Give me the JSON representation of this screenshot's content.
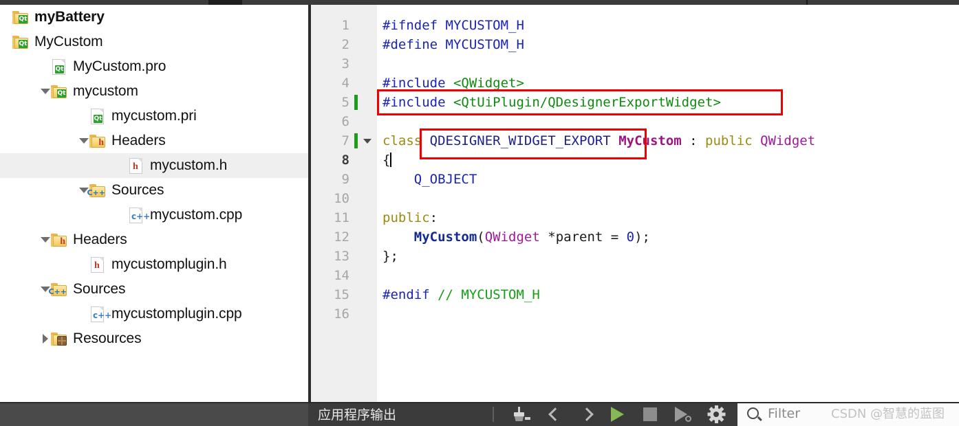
{
  "window": {
    "top_strip": {
      "active_tab_marker": ""
    }
  },
  "sidebar": {
    "name": "project-tree",
    "items": [
      {
        "label": "myBattery",
        "icon": "qt-folder-icon",
        "indent": 0,
        "twisty": "none",
        "bold": true,
        "selected": false
      },
      {
        "label": "MyCustom",
        "icon": "qt-folder-icon",
        "indent": 0,
        "twisty": "none",
        "bold": false,
        "selected": false
      },
      {
        "label": "MyCustom.pro",
        "icon": "qt-file-icon",
        "indent": 1,
        "twisty": "none",
        "bold": false,
        "selected": false
      },
      {
        "label": "mycustom",
        "icon": "qt-folder-icon",
        "indent": 1,
        "twisty": "expanded",
        "bold": false,
        "selected": false
      },
      {
        "label": "mycustom.pri",
        "icon": "qt-file-icon",
        "indent": 2,
        "twisty": "none",
        "bold": false,
        "selected": false
      },
      {
        "label": "Headers",
        "icon": "h-folder-icon",
        "indent": 2,
        "twisty": "expanded",
        "bold": false,
        "selected": false
      },
      {
        "label": "mycustom.h",
        "icon": "h-file-icon",
        "indent": 3,
        "twisty": "none",
        "bold": false,
        "selected": true
      },
      {
        "label": "Sources",
        "icon": "cpp-folder-icon",
        "indent": 2,
        "twisty": "expanded",
        "bold": false,
        "selected": false
      },
      {
        "label": "mycustom.cpp",
        "icon": "cpp-file-icon",
        "indent": 3,
        "twisty": "none",
        "bold": false,
        "selected": false
      },
      {
        "label": "Headers",
        "icon": "h-folder-icon",
        "indent": 1,
        "twisty": "expanded",
        "bold": false,
        "selected": false
      },
      {
        "label": "mycustomplugin.h",
        "icon": "h-file-icon",
        "indent": 2,
        "twisty": "none",
        "bold": false,
        "selected": false
      },
      {
        "label": "Sources",
        "icon": "cpp-folder-icon",
        "indent": 1,
        "twisty": "expanded",
        "bold": false,
        "selected": false
      },
      {
        "label": "mycustomplugin.cpp",
        "icon": "cpp-file-icon",
        "indent": 2,
        "twisty": "none",
        "bold": false,
        "selected": false
      },
      {
        "label": "Resources",
        "icon": "resource-folder-icon",
        "indent": 1,
        "twisty": "collapsed",
        "bold": false,
        "selected": false
      }
    ]
  },
  "editor": {
    "name": "code-editor",
    "filename": "mycustom.h",
    "current_line": 8,
    "lines": [
      {
        "no": "1",
        "change": false,
        "fold": false,
        "current": false,
        "tokens": [
          {
            "t": "#ifndef ",
            "c": "pre"
          },
          {
            "t": "MYCUSTOM_H",
            "c": "macro"
          }
        ]
      },
      {
        "no": "2",
        "change": false,
        "fold": false,
        "current": false,
        "tokens": [
          {
            "t": "#define ",
            "c": "pre"
          },
          {
            "t": "MYCUSTOM_H",
            "c": "macro"
          }
        ]
      },
      {
        "no": "3",
        "change": false,
        "fold": false,
        "current": false,
        "tokens": []
      },
      {
        "no": "4",
        "change": false,
        "fold": false,
        "current": false,
        "tokens": [
          {
            "t": "#include ",
            "c": "pre"
          },
          {
            "t": "<QWidget>",
            "c": "string"
          }
        ]
      },
      {
        "no": "5",
        "change": true,
        "fold": false,
        "current": false,
        "tokens": [
          {
            "t": "#include ",
            "c": "pre"
          },
          {
            "t": "<QtUiPlugin/QDesignerExportWidget>",
            "c": "string"
          }
        ]
      },
      {
        "no": "6",
        "change": false,
        "fold": false,
        "current": false,
        "tokens": []
      },
      {
        "no": "7",
        "change": true,
        "fold": true,
        "current": false,
        "tokens": [
          {
            "t": "class ",
            "c": "keyword"
          },
          {
            "t": "QDESIGNER_WIDGET_EXPORT ",
            "c": "navy"
          },
          {
            "t": "MyCustom",
            "c": "classname"
          },
          {
            "t": " : ",
            "c": "plain"
          },
          {
            "t": "public ",
            "c": "keyword"
          },
          {
            "t": "QWidget",
            "c": "type"
          }
        ]
      },
      {
        "no": "8",
        "change": false,
        "fold": false,
        "current": true,
        "tokens": [
          {
            "t": "{",
            "c": "plain"
          }
        ],
        "caret": true
      },
      {
        "no": "9",
        "change": false,
        "fold": false,
        "current": false,
        "tokens": [
          {
            "t": "    ",
            "c": "plain"
          },
          {
            "t": "Q_OBJECT",
            "c": "macro"
          }
        ]
      },
      {
        "no": "10",
        "change": false,
        "fold": false,
        "current": false,
        "tokens": []
      },
      {
        "no": "11",
        "change": false,
        "fold": false,
        "current": false,
        "tokens": [
          {
            "t": "public",
            "c": "keyword"
          },
          {
            "t": ":",
            "c": "plain"
          }
        ]
      },
      {
        "no": "12",
        "change": false,
        "fold": false,
        "current": false,
        "tokens": [
          {
            "t": "    ",
            "c": "plain"
          },
          {
            "t": "MyCustom",
            "c": "funcname"
          },
          {
            "t": "(",
            "c": "plain"
          },
          {
            "t": "QWidget",
            "c": "type"
          },
          {
            "t": " *parent = ",
            "c": "plain"
          },
          {
            "t": "0",
            "c": "num"
          },
          {
            "t": ");",
            "c": "plain"
          }
        ]
      },
      {
        "no": "13",
        "change": false,
        "fold": false,
        "current": false,
        "tokens": [
          {
            "t": "};",
            "c": "plain"
          }
        ]
      },
      {
        "no": "14",
        "change": false,
        "fold": false,
        "current": false,
        "tokens": []
      },
      {
        "no": "15",
        "change": false,
        "fold": false,
        "current": false,
        "tokens": [
          {
            "t": "#endif ",
            "c": "pre"
          },
          {
            "t": "// MYCUSTOM_H",
            "c": "comment"
          }
        ]
      },
      {
        "no": "16",
        "change": false,
        "fold": false,
        "current": false,
        "tokens": []
      }
    ],
    "annotations": [
      {
        "name": "include-highlight-box",
        "color": "#ee0000",
        "target_line": 5
      },
      {
        "name": "export-macro-highlight-box",
        "color": "#ee0000",
        "target_line": 7
      }
    ]
  },
  "bottom_bar": {
    "output_label": "应用程序输出",
    "buttons": [
      {
        "name": "clear-output-button",
        "icon": "broom-icon"
      },
      {
        "name": "previous-item-button",
        "icon": "chevron-left-icon"
      },
      {
        "name": "next-item-button",
        "icon": "chevron-right-icon"
      },
      {
        "name": "run-button",
        "icon": "play-icon"
      },
      {
        "name": "stop-button",
        "icon": "stop-icon"
      },
      {
        "name": "debug-button",
        "icon": "play-debug-icon"
      },
      {
        "name": "settings-button",
        "icon": "gear-icon"
      }
    ],
    "filter": {
      "name": "filter-input",
      "placeholder": "Filter",
      "value": "",
      "icon": "search-icon"
    }
  },
  "watermark": {
    "text": "CSDN @智慧的蓝图"
  },
  "colors": {
    "accent_red": "#ee0000",
    "change_bar_green": "#1d9b1d",
    "chrome_dark": "#3b3b3b",
    "selection_gray": "#efefef",
    "run_green": "#86b855"
  }
}
